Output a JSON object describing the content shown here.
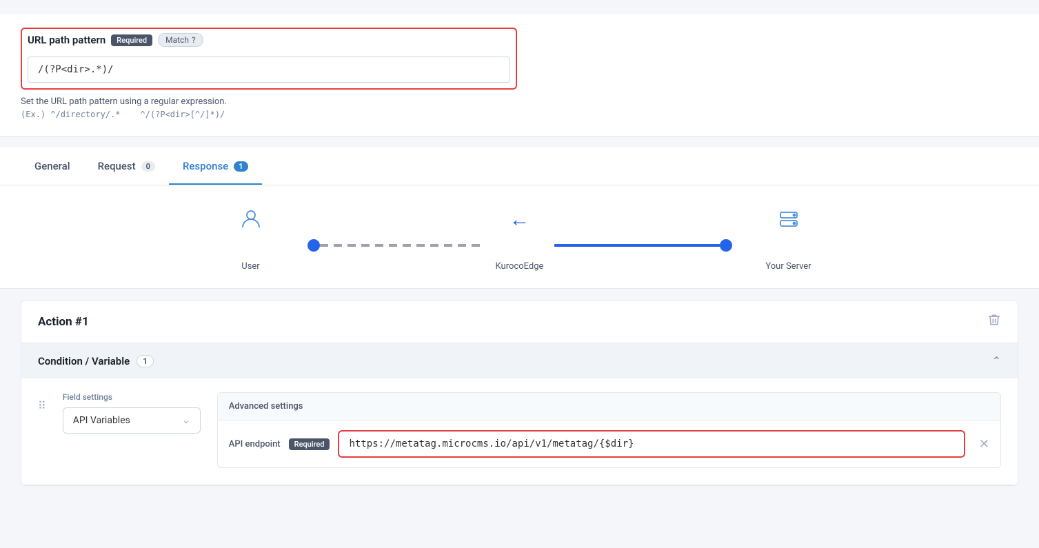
{
  "url_section": {
    "label": "URL path pattern",
    "badge_required": "Required",
    "badge_match": "Match",
    "input_value": "/(?P<dir>.*)/",
    "hint": "Set the URL path pattern using a regular expression.",
    "examples_prefix": "(Ex.)",
    "example1": "^/directory/.*",
    "example2": "^/(?P<dir>[^/]*)/"
  },
  "tabs": {
    "items": [
      {
        "label": "General",
        "badge": null,
        "active": false
      },
      {
        "label": "Request",
        "badge": "0",
        "active": false
      },
      {
        "label": "Response",
        "badge": "1",
        "active": true
      }
    ]
  },
  "diagram": {
    "user_label": "User",
    "edge_label": "KurocoEdge",
    "server_label": "Your Server"
  },
  "action": {
    "title": "Action #1",
    "delete_label": "delete"
  },
  "condition": {
    "title": "Condition / Variable",
    "badge": "1",
    "field_settings_label": "Field settings",
    "field_select_value": "API Variables",
    "advanced_settings_label": "Advanced settings",
    "api_endpoint_label": "API endpoint",
    "api_endpoint_badge": "Required",
    "api_endpoint_value": "https://metatag.microcms.io/api/v1/metatag/{$dir}"
  }
}
